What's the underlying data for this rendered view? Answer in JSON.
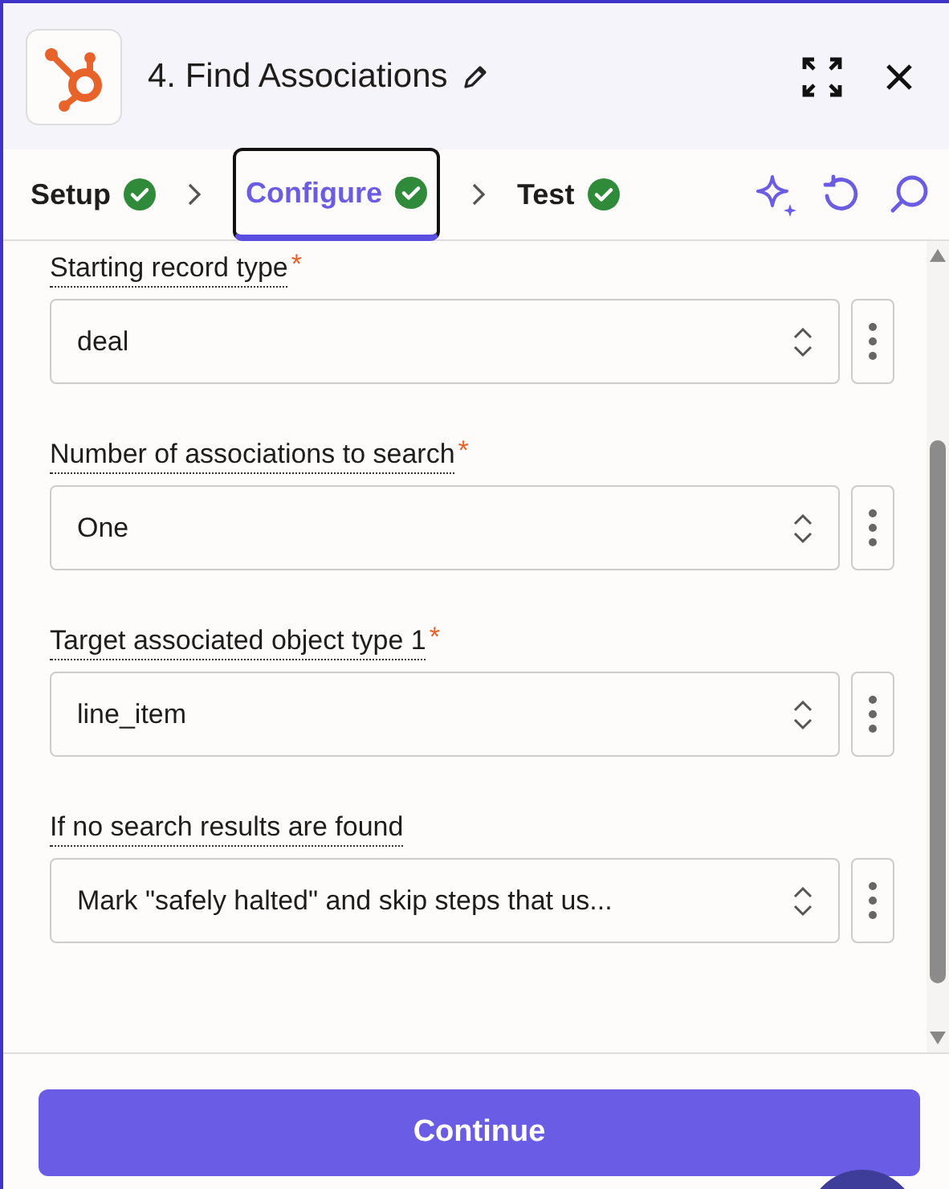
{
  "header": {
    "title": "4. Find Associations"
  },
  "tabs": [
    {
      "label": "Setup",
      "selected": false,
      "complete": true
    },
    {
      "label": "Configure",
      "selected": true,
      "complete": true
    },
    {
      "label": "Test",
      "selected": false,
      "complete": true
    }
  ],
  "fields": [
    {
      "label": "Starting record type",
      "required": true,
      "value": "deal"
    },
    {
      "label": "Number of associations to search",
      "required": true,
      "value": "One"
    },
    {
      "label": "Target associated object type 1",
      "required": true,
      "value": "line_item"
    },
    {
      "label": "If no search results are found",
      "required": false,
      "value": "Mark \"safely halted\" and skip steps that us..."
    }
  ],
  "required_mark": "*",
  "continue_button": "Continue"
}
